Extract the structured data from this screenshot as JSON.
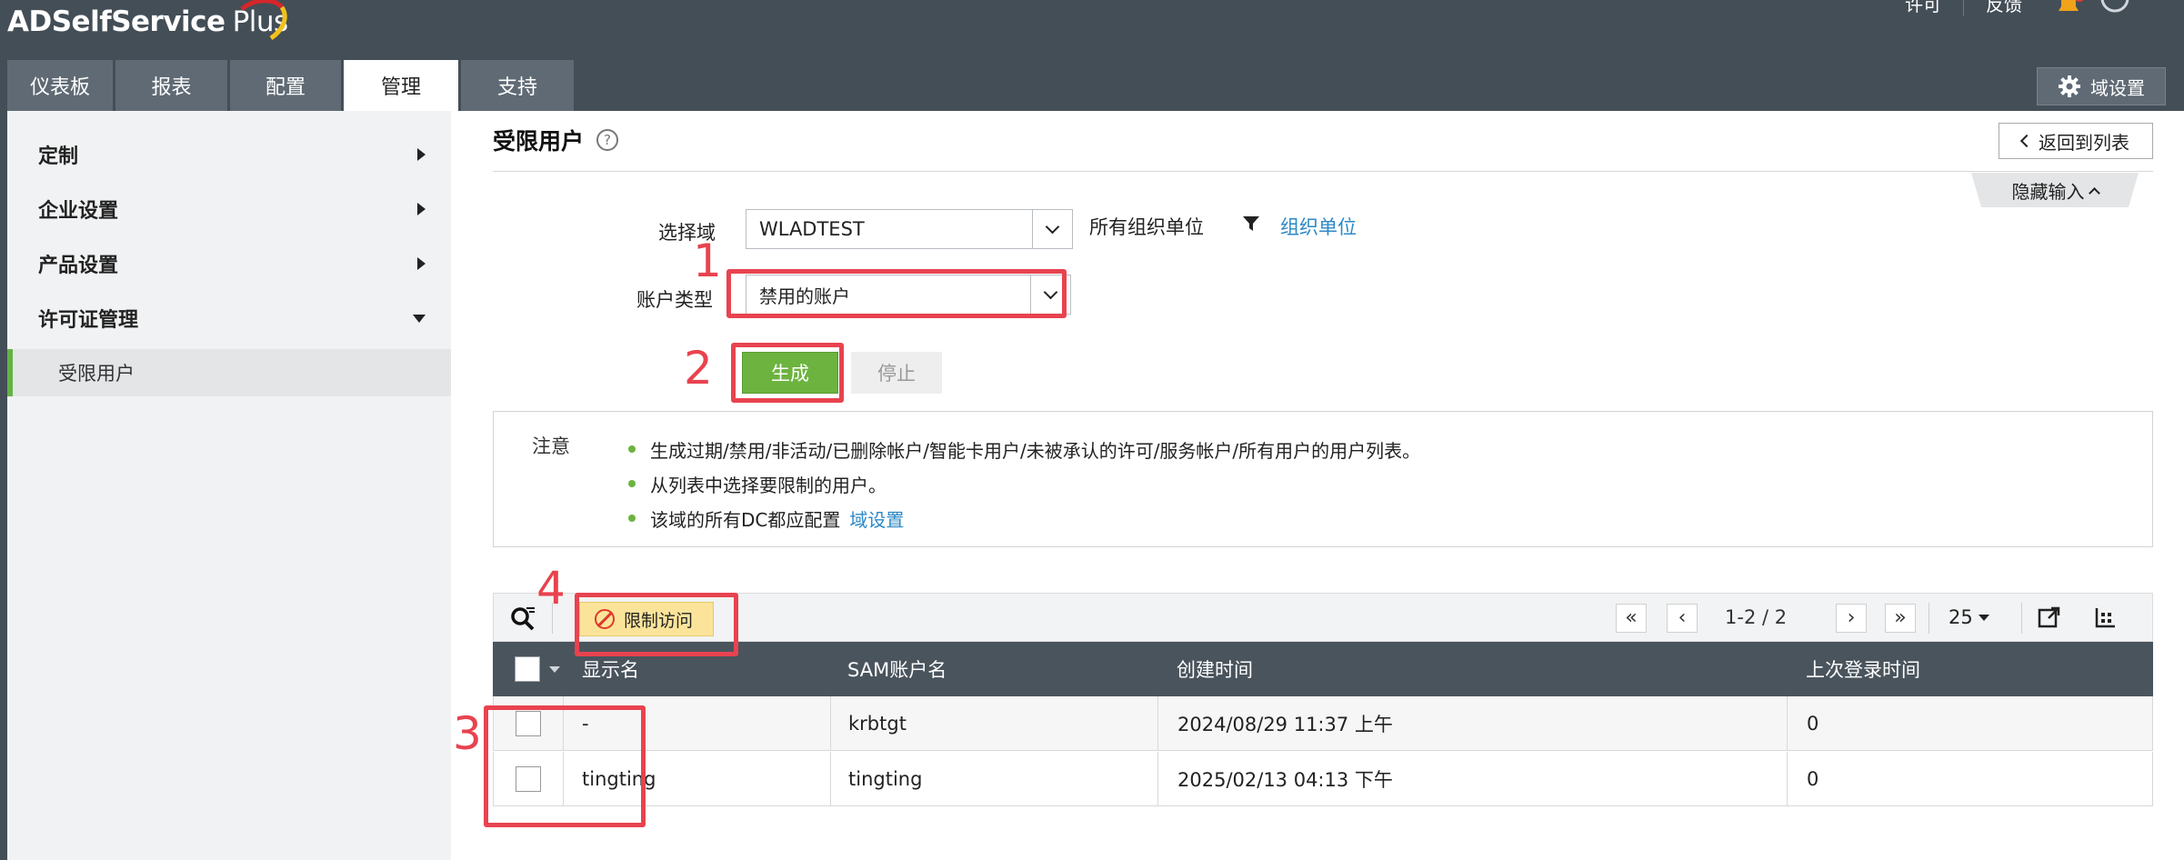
{
  "header": {
    "logo_main": "ADSelfService",
    "logo_plus": "Plus",
    "top_links": [
      "许可",
      "反馈"
    ],
    "nav_tabs": [
      {
        "label": "仪表板",
        "active": false
      },
      {
        "label": "报表",
        "active": false
      },
      {
        "label": "配置",
        "active": false
      },
      {
        "label": "管理",
        "active": true
      },
      {
        "label": "支持",
        "active": false
      }
    ],
    "domain_settings_label": "域设置"
  },
  "sidebar": {
    "items": [
      {
        "label": "定制",
        "expanded": false
      },
      {
        "label": "企业设置",
        "expanded": false
      },
      {
        "label": "产品设置",
        "expanded": false
      },
      {
        "label": "许可证管理",
        "expanded": true
      }
    ],
    "sub_item": "受限用户"
  },
  "page": {
    "title": "受限用户",
    "help_symbol": "?",
    "back_label": "返回到列表",
    "hide_input_label": "隐藏输入"
  },
  "form": {
    "domain_label": "选择域",
    "domain_value": "WLADTEST",
    "ou_label": "所有组织单位",
    "ou_link": "组织单位",
    "account_type_label": "账户类型",
    "account_type_value": "禁用的账户",
    "generate_label": "生成",
    "stop_label": "停止"
  },
  "note": {
    "label": "注意",
    "items": [
      "生成过期/禁用/非活动/已删除帐户/智能卡用户/未被承认的许可/服务帐户/所有用户的用户列表。",
      "从列表中选择要限制的用户。",
      "该域的所有DC都应配置"
    ],
    "item3_link": "域设置"
  },
  "toolbar": {
    "restrict_label": "限制访问",
    "range_text": "1-2 / 2",
    "per_page": "25"
  },
  "table": {
    "columns": [
      "显示名",
      "SAM账户名",
      "创建时间",
      "上次登录时间"
    ],
    "rows": [
      {
        "display_name": "-",
        "sam": "krbtgt",
        "created": "2024/08/29 11:37 上午",
        "last_logon": "0"
      },
      {
        "display_name": "tingting",
        "sam": "tingting",
        "created": "2025/02/13 04:13 下午",
        "last_logon": "0"
      }
    ]
  },
  "annotations": [
    "1",
    "2",
    "3",
    "4"
  ],
  "colors": {
    "header_bg": "#444e57",
    "accent_green": "#6cb33f",
    "link_blue": "#2b88c6",
    "annotation_red": "#e8434f",
    "restrict_yellow": "#fbe49a"
  }
}
